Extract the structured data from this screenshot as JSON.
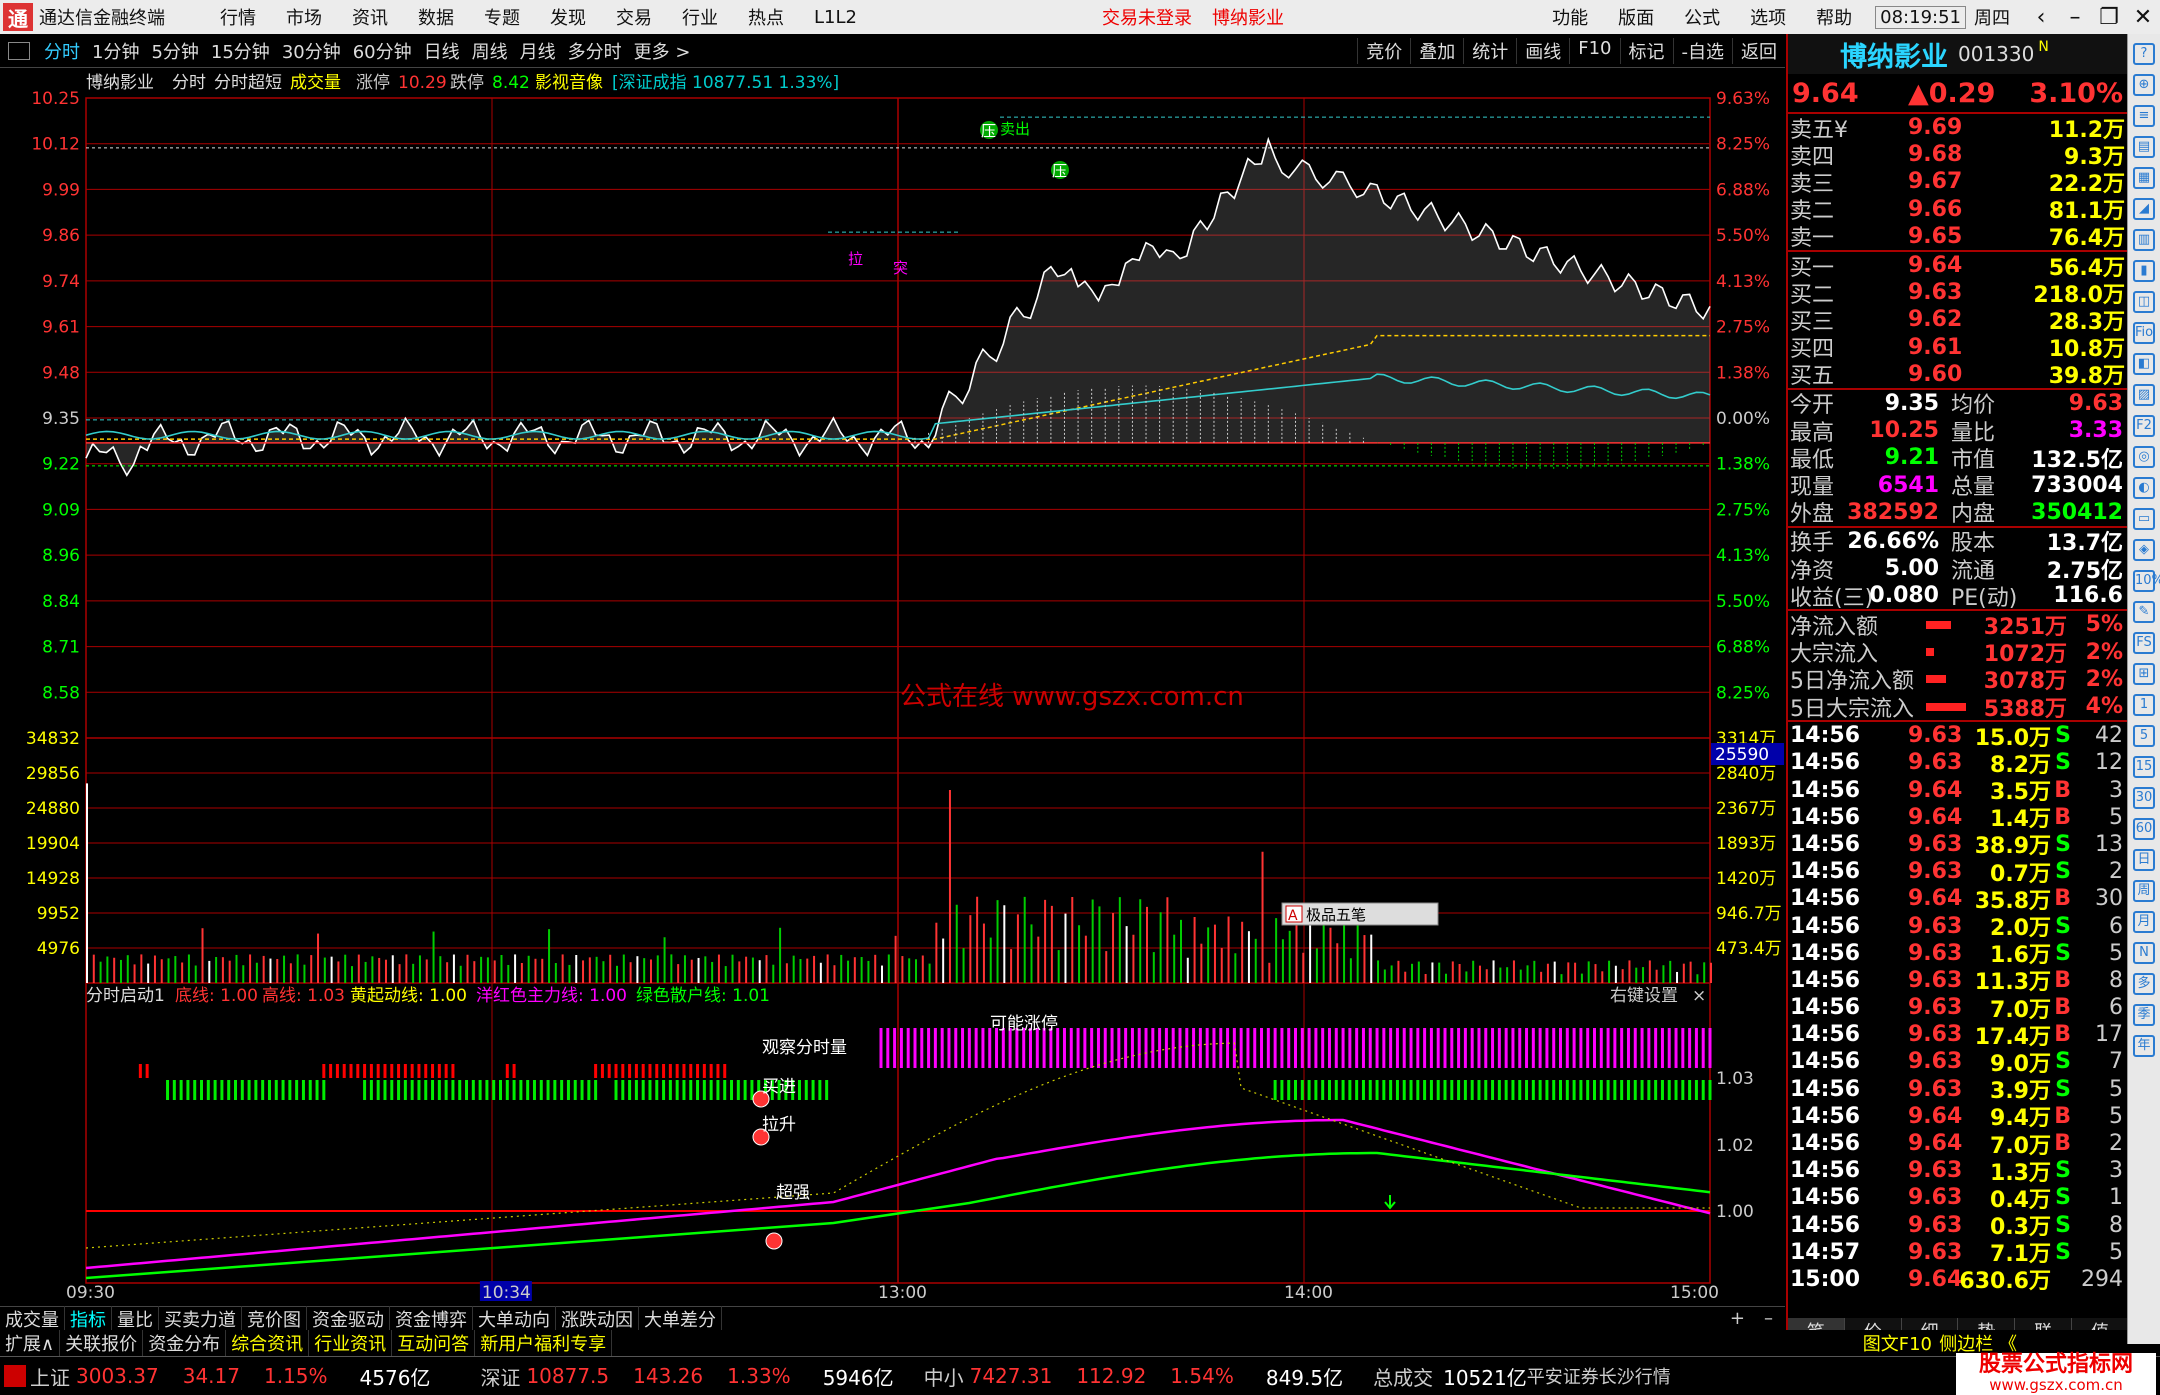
{
  "titlebar": {
    "app": "通达信金融终端",
    "menus": [
      "行情",
      "市场",
      "资讯",
      "数据",
      "专题",
      "发现",
      "交易",
      "行业",
      "热点",
      "L1L2"
    ],
    "notice": "交易未登录",
    "stock": "博纳影业",
    "right": [
      "功能",
      "版面",
      "公式",
      "选项",
      "帮助"
    ],
    "time": "08:19:51",
    "weekday": "周四"
  },
  "periods": [
    "分时",
    "1分钟",
    "5分钟",
    "15分钟",
    "30分钟",
    "60分钟",
    "日线",
    "周线",
    "月线",
    "多分时",
    "更多 >"
  ],
  "tools": [
    "竞价",
    "叠加",
    "统计",
    "画线",
    "F10",
    "标记",
    "-自选",
    "返回"
  ],
  "chart_header": {
    "name": "博纳影业",
    "mode": "分时",
    "formula": "分时超短",
    "vol": "成交量",
    "up_label": "涨停",
    "up_val": "10.29",
    "down_label": "跌停",
    "down_val": "8.42",
    "concept": "影视音像",
    "index": "[深证成指 10877.51 1.33%]"
  },
  "price_ticks": [
    "10.25",
    "10.12",
    "9.99",
    "9.86",
    "9.74",
    "9.61",
    "9.48",
    "9.35",
    "9.22",
    "9.09",
    "8.96",
    "8.84",
    "8.71",
    "8.58"
  ],
  "pct_ticks": [
    "9.63%",
    "8.25%",
    "6.88%",
    "5.50%",
    "4.13%",
    "2.75%",
    "1.38%",
    "0.00%",
    "1.38%",
    "2.75%",
    "4.13%",
    "5.50%",
    "6.88%",
    "8.25%"
  ],
  "vol_ticks": [
    "34832",
    "29856",
    "24880",
    "19904",
    "14928",
    "9952",
    "4976"
  ],
  "amt_ticks": [
    "3314万",
    "2840万",
    "2367万",
    "1893万",
    "1420万",
    "946.7万",
    "473.4万"
  ],
  "vol_cursor": "25590",
  "watermark": "公式在线 www.gszx.com.cn",
  "pad_label": "极品五笔",
  "indicator": {
    "name": "分时启动1",
    "l1": "底线: 1.00",
    "l2": "高线: 1.03",
    "l3": "黄起动线: 1.00",
    "l4": "洋红色主力线: 1.00",
    "l5": "绿色散户线: 1.01",
    "settings": "右键设置",
    "ticks": [
      "1.03",
      "1.02",
      "1.00"
    ],
    "labels": {
      "observe": "观察分时量",
      "possible": "可能涨停",
      "buy": "买进",
      "pull": "拉升",
      "strong": "超强"
    }
  },
  "marks": {
    "ya": "压",
    "sell": "卖出",
    "la": "拉",
    "tu": "突"
  },
  "time_axis": [
    "09:30",
    "10:34",
    "13:00",
    "14:00",
    "15:00"
  ],
  "stock": {
    "name": "博纳影业",
    "code": "001330",
    "flag": "N",
    "price": "9.64",
    "chg": "▲0.29",
    "pct": "3.10%"
  },
  "asks": [
    [
      "卖五¥",
      "9.69",
      "11.2万"
    ],
    [
      "卖四",
      "9.68",
      "9.3万"
    ],
    [
      "卖三",
      "9.67",
      "22.2万"
    ],
    [
      "卖二",
      "9.66",
      "81.1万"
    ],
    [
      "卖一",
      "9.65",
      "76.4万"
    ]
  ],
  "bids": [
    [
      "买一",
      "9.64",
      "56.4万"
    ],
    [
      "买二",
      "9.63",
      "218.0万"
    ],
    [
      "买三",
      "9.62",
      "28.3万"
    ],
    [
      "买四",
      "9.61",
      "10.8万"
    ],
    [
      "买五",
      "9.60",
      "39.8万"
    ]
  ],
  "stats": [
    [
      "今开",
      "9.35",
      "均价",
      "9.63"
    ],
    [
      "最高",
      "10.25",
      "量比",
      "3.33"
    ],
    [
      "最低",
      "9.21",
      "市值",
      "132.5亿"
    ],
    [
      "现量",
      "6541",
      "总量",
      "733004"
    ],
    [
      "外盘",
      "382592",
      "内盘",
      "350412"
    ]
  ],
  "stats2": [
    [
      "换手",
      "26.66%",
      "股本",
      "13.7亿"
    ],
    [
      "净资",
      "5.00",
      "流通",
      "2.75亿"
    ],
    [
      "收益(三)",
      "0.080",
      "PE(动)",
      "116.6"
    ]
  ],
  "flows": [
    [
      "净流入额",
      "3251万",
      "5%"
    ],
    [
      "大宗流入",
      "1072万",
      "2%"
    ],
    [
      "5日净流入额",
      "3078万",
      "2%"
    ],
    [
      "5日大宗流入",
      "5388万",
      "4%"
    ]
  ],
  "ticks": [
    [
      "14:56",
      "9.63",
      "15.0万",
      "S",
      "42"
    ],
    [
      "14:56",
      "9.63",
      "8.2万",
      "S",
      "12"
    ],
    [
      "14:56",
      "9.64",
      "3.5万",
      "B",
      "3"
    ],
    [
      "14:56",
      "9.64",
      "1.4万",
      "B",
      "5"
    ],
    [
      "14:56",
      "9.63",
      "38.9万",
      "S",
      "13"
    ],
    [
      "14:56",
      "9.63",
      "0.7万",
      "S",
      "2"
    ],
    [
      "14:56",
      "9.64",
      "35.8万",
      "B",
      "30"
    ],
    [
      "14:56",
      "9.63",
      "2.0万",
      "S",
      "6"
    ],
    [
      "14:56",
      "9.63",
      "1.6万",
      "S",
      "5"
    ],
    [
      "14:56",
      "9.63",
      "11.3万",
      "B",
      "8"
    ],
    [
      "14:56",
      "9.63",
      "7.0万",
      "B",
      "6"
    ],
    [
      "14:56",
      "9.63",
      "17.4万",
      "B",
      "17"
    ],
    [
      "14:56",
      "9.63",
      "9.0万",
      "S",
      "7"
    ],
    [
      "14:56",
      "9.63",
      "3.9万",
      "S",
      "5"
    ],
    [
      "14:56",
      "9.64",
      "9.4万",
      "B",
      "5"
    ],
    [
      "14:56",
      "9.64",
      "7.0万",
      "B",
      "2"
    ],
    [
      "14:56",
      "9.63",
      "1.3万",
      "S",
      "3"
    ],
    [
      "14:56",
      "9.63",
      "0.4万",
      "S",
      "1"
    ],
    [
      "14:56",
      "9.63",
      "0.3万",
      "S",
      "8"
    ],
    [
      "14:57",
      "9.63",
      "7.1万",
      "S",
      "5"
    ],
    [
      "15:00",
      "9.64",
      "630.6万",
      "",
      "294"
    ]
  ],
  "rp_tabs": [
    "笔",
    "价",
    "细",
    "势",
    "联",
    "值"
  ],
  "sidebar_icons": [
    "?",
    "⊕",
    "≡",
    "▤",
    "▦",
    "◢",
    "▥",
    "▮",
    "◫",
    "Fio",
    "◧",
    "▨",
    "F2",
    "◎",
    "◐",
    "▭",
    "◈",
    "10%",
    "✎",
    "FS",
    "⊞",
    "1",
    "5",
    "15",
    "30",
    "60",
    "日",
    "周",
    "月",
    "N",
    "多",
    "季",
    "年"
  ],
  "bottom_tabs": [
    "成交量",
    "指标",
    "量比",
    "买卖力道",
    "竞价图",
    "资金驱动",
    "资金博弈",
    "大单动向",
    "涨跌动因",
    "大单差分"
  ],
  "ext_tabs": [
    "扩展∧",
    "关联报价",
    "资金分布",
    "综合资讯",
    "行业资讯",
    "互动问答",
    "新用户福利专享"
  ],
  "ext_right": [
    "图文F10",
    "侧边栏 《"
  ],
  "status": {
    "sh_name": "上证",
    "sh": "3003.37",
    "sh_chg": "34.17",
    "sh_pct": "1.15%",
    "sh_amt": "4576亿",
    "sz_name": "深证",
    "sz": "10877.5",
    "sz_chg": "143.26",
    "sz_pct": "1.33%",
    "sz_amt": "5946亿",
    "zx_name": "中小",
    "zx": "7427.31",
    "zx_chg": "112.92",
    "zx_pct": "1.54%",
    "zx_amt": "849.5亿",
    "total_name": "总成交",
    "total": "10521亿",
    "broker": "平安证券长沙行情",
    "brand": "股票公式指标网",
    "brand_url": "www.gszx.com.cn"
  }
}
